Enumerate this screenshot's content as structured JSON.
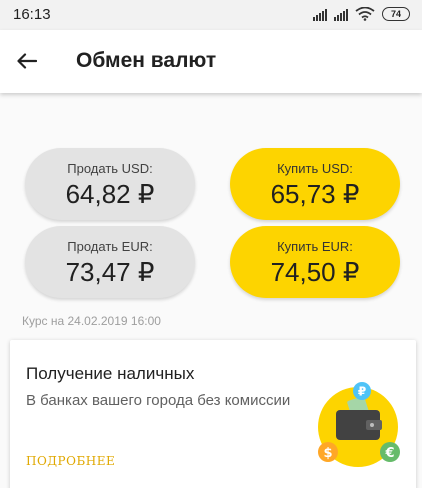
{
  "status_bar": {
    "time": "16:13",
    "battery": "74"
  },
  "app_bar": {
    "title": "Обмен валют",
    "back_icon": "arrow-back-icon"
  },
  "rates": {
    "sell_usd": {
      "label": "Продать USD:",
      "value": "64,82 ₽"
    },
    "buy_usd": {
      "label": "Купить USD:",
      "value": "65,73 ₽"
    },
    "sell_eur": {
      "label": "Продать EUR:",
      "value": "73,47 ₽"
    },
    "buy_eur": {
      "label": "Купить EUR:",
      "value": "74,50 ₽"
    },
    "date": "Курс на 24.02.2019 16:00"
  },
  "card": {
    "title": "Получение наличных",
    "description": "В банках вашего города без комиссии",
    "more": "ПОДРОБНЕЕ",
    "icons": {
      "ruble": "₽",
      "dollar": "$",
      "euro": "€"
    }
  },
  "colors": {
    "accent_yellow": "#fdd400",
    "sell_gray": "#e3e3e3",
    "ruble_coin": "#4fc3f7",
    "dollar_coin": "#ffa726",
    "euro_coin": "#66bb6a"
  }
}
